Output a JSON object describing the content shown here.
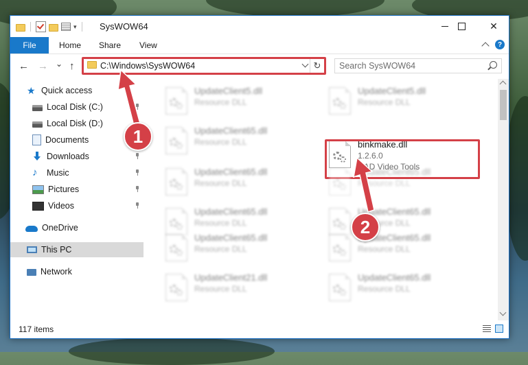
{
  "window": {
    "title": "SysWOW64",
    "controls": {
      "minimize_label": "",
      "maximize_label": "",
      "close_label": "✕"
    }
  },
  "ribbon": {
    "tabs": [
      {
        "label": "File",
        "active": true
      },
      {
        "label": "Home"
      },
      {
        "label": "Share"
      },
      {
        "label": "View"
      }
    ],
    "help_label": "?"
  },
  "navigation": {
    "back_label": "←",
    "forward_label": "→",
    "recent_label": "⌄",
    "up_label": "↑",
    "refresh_label": "↻"
  },
  "address": {
    "path": "C:\\Windows\\SysWOW64"
  },
  "search": {
    "placeholder": "Search SysWOW64"
  },
  "sidebar": {
    "items": [
      {
        "label": "Quick access",
        "icon": "star-icon",
        "pinned": false
      },
      {
        "label": "Local Disk (C:)",
        "icon": "drive-icon",
        "pinned": true
      },
      {
        "label": "Local Disk (D:)",
        "icon": "drive-icon",
        "pinned": false
      },
      {
        "label": "Documents",
        "icon": "document-icon",
        "pinned": true
      },
      {
        "label": "Downloads",
        "icon": "download-icon",
        "pinned": true
      },
      {
        "label": "Music",
        "icon": "music-icon",
        "pinned": true
      },
      {
        "label": "Pictures",
        "icon": "pictures-icon",
        "pinned": true
      },
      {
        "label": "Videos",
        "icon": "videos-icon",
        "pinned": true
      },
      {
        "label": "OneDrive",
        "icon": "cloud-icon",
        "pinned": false
      },
      {
        "label": "This PC",
        "icon": "computer-icon",
        "pinned": false,
        "selected": true
      },
      {
        "label": "Network",
        "icon": "network-icon",
        "pinned": false
      }
    ]
  },
  "files": [
    {
      "name": "UpdateClient5.dll",
      "type": "Resource DLL",
      "blurred": true
    },
    {
      "name": "UpdateClient5.dll",
      "type": "Resource DLL",
      "blurred": true
    },
    {
      "name": "UpdateClient65.dll",
      "type": "Resource DLL",
      "blurred": true
    },
    {
      "name": "binkmake.dll",
      "version": "1.2.6.0",
      "company": "RAD Video Tools",
      "blurred": false,
      "highlighted": true
    },
    {
      "name": "UpdateClient65.dll",
      "type": "Resource DLL",
      "blurred": true
    },
    {
      "name": "UpdateClient65.dll",
      "type": "Resource DLL",
      "blurred": true
    },
    {
      "name": "UpdateClient65.dll",
      "type": "Resource DLL",
      "blurred": true
    },
    {
      "name": "UpdateClient65.dll",
      "type": "Resource DLL",
      "blurred": true
    },
    {
      "name": "UpdateClient65.dll",
      "type": "Resource DLL",
      "blurred": true
    },
    {
      "name": "UpdateClient65.dll",
      "type": "Resource DLL",
      "blurred": true
    },
    {
      "name": "UpdateClient21.dll",
      "type": "Resource DLL",
      "blurred": true
    },
    {
      "name": "UpdateClient65.dll",
      "type": "Resource DLL",
      "blurred": true
    }
  ],
  "status": {
    "item_count": "117 items"
  },
  "annotations": {
    "step1": "1",
    "step2": "2",
    "color": "#d44047"
  },
  "colors": {
    "accent": "#1979ca",
    "highlight": "#d44047",
    "selection": "#d9d9d9"
  }
}
